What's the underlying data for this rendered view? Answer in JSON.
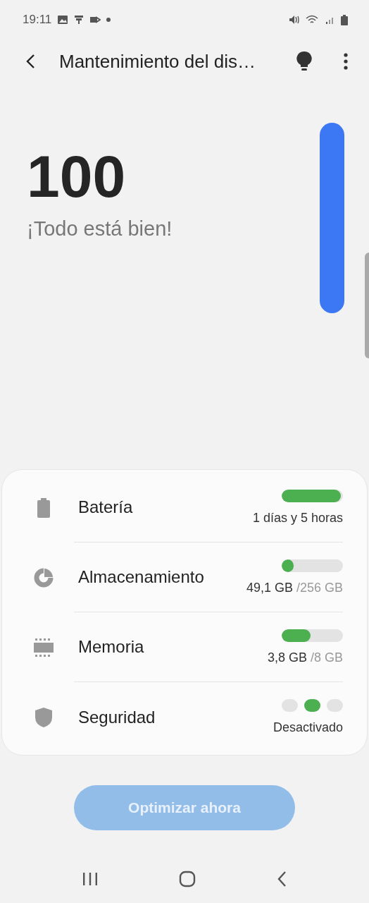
{
  "status_bar": {
    "time": "19:11"
  },
  "toolbar": {
    "title": "Mantenimiento del dis…"
  },
  "score": {
    "value": "100",
    "message": "¡Todo está bien!"
  },
  "items": [
    {
      "kind": "bar",
      "label": "Batería",
      "level": 0.97,
      "value": "1 días y 5 horas"
    },
    {
      "kind": "bar",
      "label": "Almacenamiento",
      "level": 0.19,
      "value": "49,1 GB",
      "total": "/256 GB"
    },
    {
      "kind": "bar",
      "label": "Memoria",
      "level": 0.47,
      "value": "3,8 GB",
      "total": "/8 GB"
    },
    {
      "kind": "dots",
      "label": "Seguridad",
      "dots": [
        {
          "selected": false
        },
        {
          "selected": true
        },
        {
          "selected": false
        }
      ],
      "value": "Desactivado"
    }
  ],
  "action": {
    "label": "Optimizar ahora",
    "disabled": true
  }
}
